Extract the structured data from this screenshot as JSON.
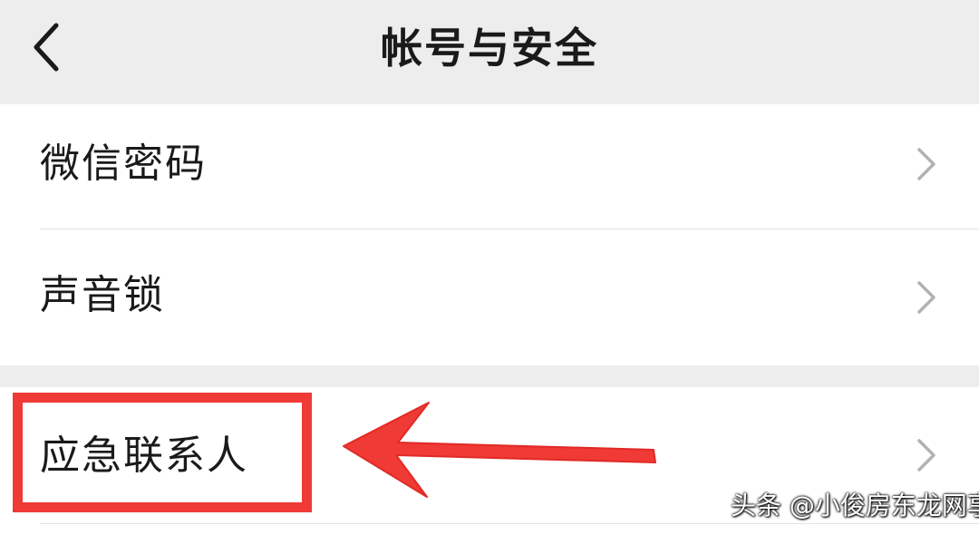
{
  "header": {
    "title": "帐号与安全",
    "back_icon": "chevron-left-icon"
  },
  "settings": {
    "group1": [
      {
        "label": "微信密码",
        "icon": "chevron-right-icon"
      },
      {
        "label": "声音锁",
        "icon": "chevron-right-icon"
      }
    ],
    "group2": [
      {
        "label": "应急联系人",
        "icon": "chevron-right-icon"
      }
    ]
  },
  "annotation": {
    "highlight_color": "#f03a36",
    "arrow_color": "#f03a36"
  },
  "watermark": {
    "text": "头条 @小俊房东龙网享"
  },
  "colors": {
    "background": "#ededed",
    "card": "#ffffff",
    "text": "#1a1a1a",
    "chevron": "#b2b2b2"
  }
}
